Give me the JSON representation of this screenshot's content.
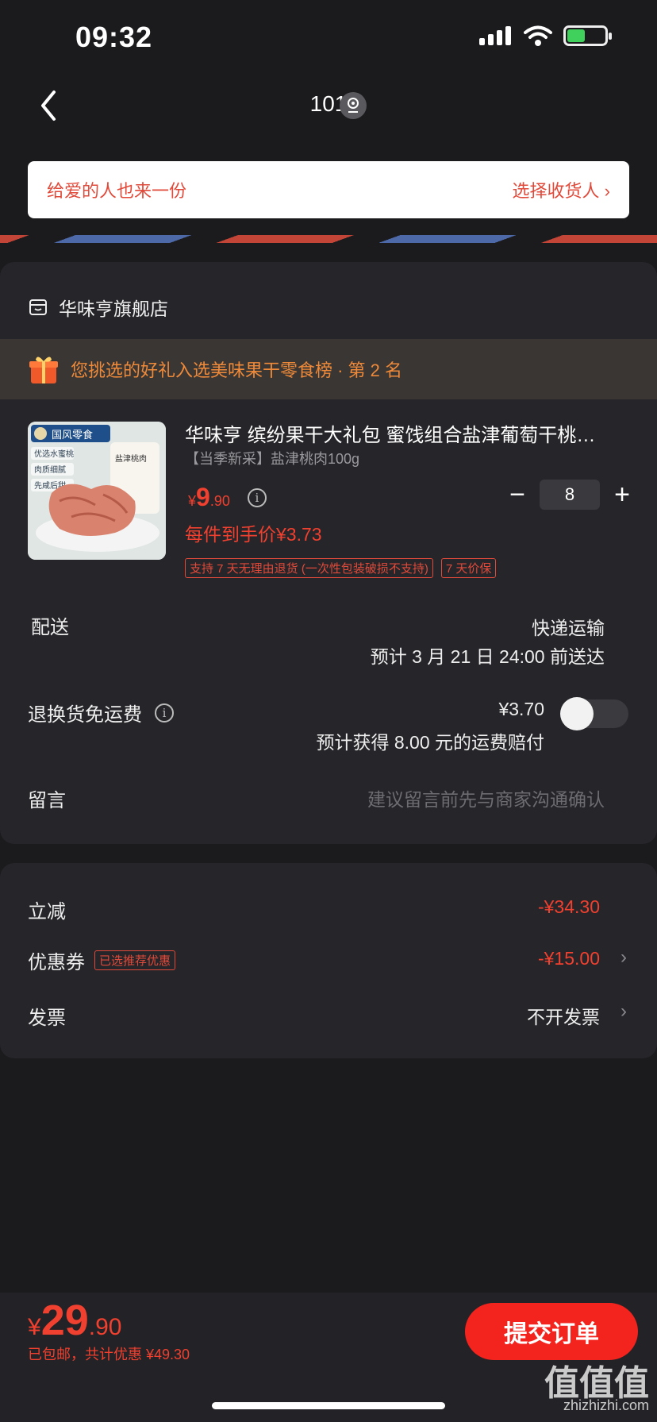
{
  "status": {
    "time": "09:32"
  },
  "nav": {
    "title": "101"
  },
  "gift_banner": {
    "left_text": "给爱的人也来一份",
    "right_text": "选择收货人 ›"
  },
  "shop": {
    "name": "华味亨旗舰店"
  },
  "rank": {
    "text": "您挑选的好礼入选美味果干零食榜 · 第 2 名"
  },
  "product": {
    "title": "华味亨 缤纷果干大礼包 蜜饯组合盐津葡萄干桃…",
    "spec": "【当季新采】盐津桃肉100g",
    "price_currency": "¥",
    "price_int": "9",
    "price_dec": ".90",
    "unit_price": "每件到手价¥3.73",
    "quantity": "8",
    "minus": "−",
    "plus": "+",
    "image_brand": "国风零食",
    "image_labels": [
      "优选水蜜桃",
      "肉质细腻",
      "先咸后甜"
    ],
    "image_pack": "盐津桃肉",
    "tags": [
      "支持 7 天无理由退货 (一次性包装破损不支持)",
      "7 天价保"
    ]
  },
  "delivery": {
    "label": "配送",
    "method": "快递运输",
    "eta": "预计 3 月 21 日 24:00 前送达"
  },
  "return_insurance": {
    "label": "退换货免运费",
    "price": "¥3.70",
    "note": "预计获得 8.00 元的运费赔付",
    "enabled": false
  },
  "message": {
    "label": "留言",
    "placeholder": "建议留言前先与商家沟通确认"
  },
  "discounts": {
    "instant_label": "立减",
    "instant_value": "-¥34.30",
    "coupon_label": "优惠券",
    "coupon_tag": "已选推荐优惠",
    "coupon_value": "-¥15.00",
    "invoice_label": "发票",
    "invoice_value": "不开发票"
  },
  "footer": {
    "currency": "¥",
    "total_int": "29",
    "total_dec": ".90",
    "sub": "已包邮，共计优惠 ¥49.30",
    "submit": "提交订单"
  },
  "watermark": {
    "main": "值值值",
    "sub": "zhizhizhi.com"
  },
  "colors": {
    "accent": "#f0402f",
    "background": "#1b1a1d",
    "card": "#262529",
    "orange": "#ef8a3a"
  }
}
